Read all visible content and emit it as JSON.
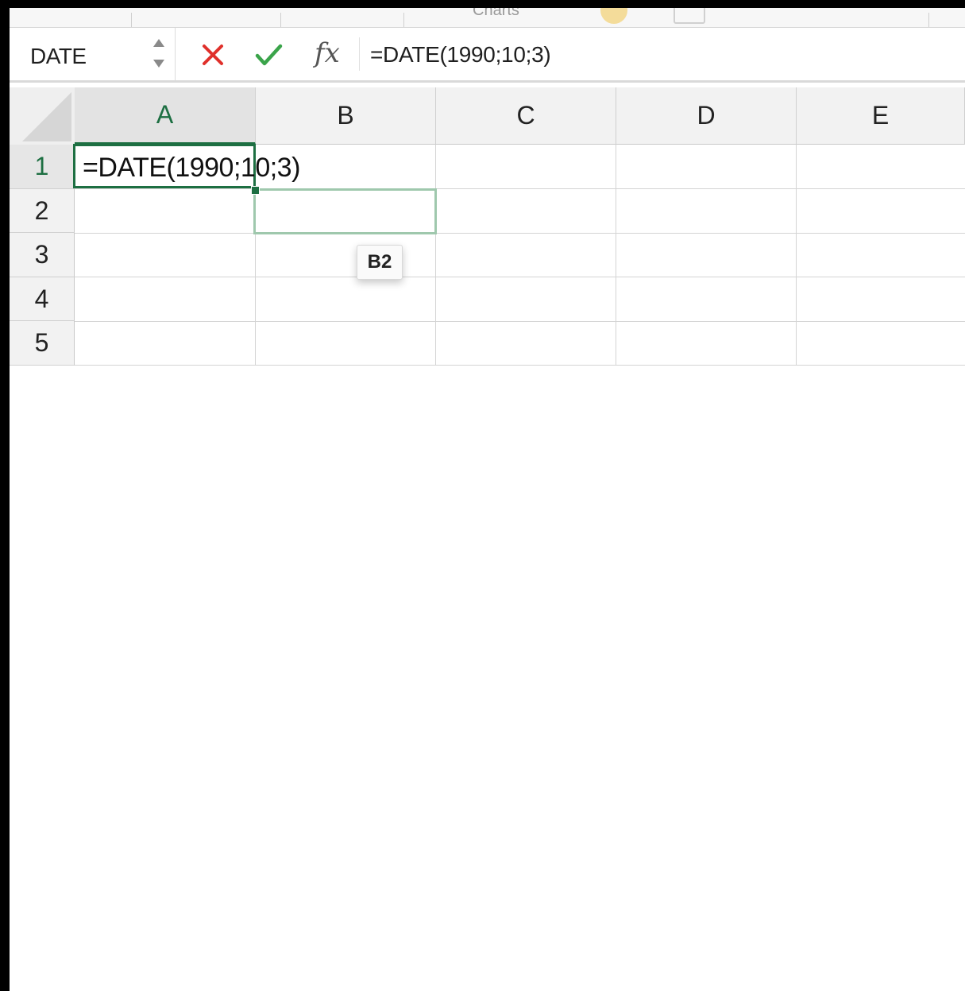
{
  "ribbon": {
    "partial_label": "Charts"
  },
  "formula_bar": {
    "name_box": "DATE",
    "formula": "=DATE(1990;10;3)",
    "fx_label": "fx"
  },
  "grid": {
    "columns": [
      "A",
      "B",
      "C",
      "D",
      "E"
    ],
    "rows": [
      "1",
      "2",
      "3",
      "4",
      "5"
    ],
    "cell_a1": "=DATE(1990;10;3)",
    "tooltip": "B2"
  },
  "colors": {
    "accent_green": "#1d6f42",
    "cancel_red": "#e0302b",
    "enter_green": "#3aa44a"
  }
}
